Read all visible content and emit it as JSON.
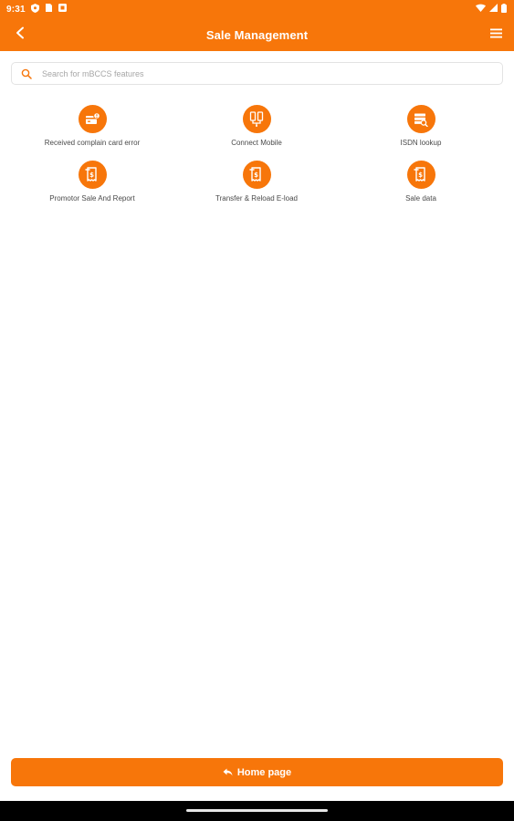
{
  "status_bar": {
    "time": "9:31",
    "left_icons": [
      "shield-icon",
      "sim-card-icon",
      "notification-square-icon"
    ],
    "right_icons": [
      "wifi-icon",
      "signal-icon",
      "battery-icon"
    ]
  },
  "app_bar": {
    "title": "Sale Management",
    "back_icon": "back-arrow-icon",
    "menu_icon": "hamburger-menu-icon"
  },
  "search": {
    "placeholder": "Search for mBCCS features",
    "value": ""
  },
  "features": [
    {
      "label": "Received complain card error",
      "icon": "card-error-icon"
    },
    {
      "label": "Connect Mobile",
      "icon": "connect-mobile-icon"
    },
    {
      "label": "ISDN lookup",
      "icon": "isdn-lookup-icon"
    },
    {
      "label": "Promotor Sale And Report",
      "icon": "receipt-icon"
    },
    {
      "label": "Transfer & Reload E-load",
      "icon": "receipt-icon"
    },
    {
      "label": "Sale data",
      "icon": "receipt-icon"
    }
  ],
  "home_button": {
    "label": "Home page",
    "icon": "reply-arrow-icon"
  },
  "colors": {
    "accent": "#f7760a",
    "background": "#ffffff",
    "nav_bar": "#000000"
  }
}
